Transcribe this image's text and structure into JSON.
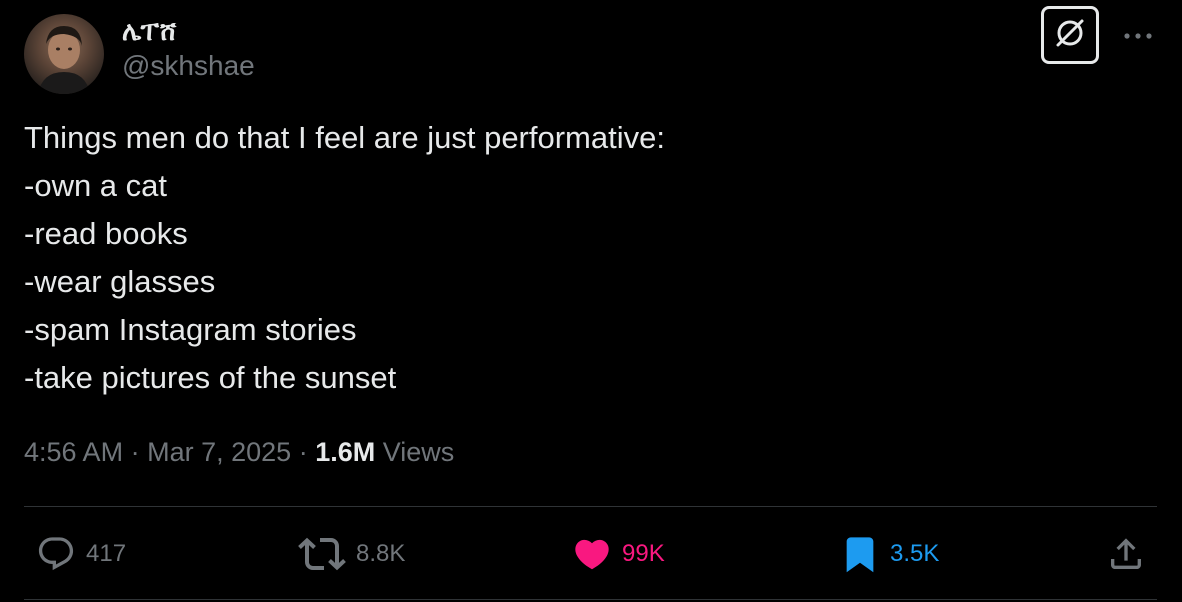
{
  "author": {
    "display_name": "ሌፐሸ",
    "handle": "@skhshae"
  },
  "tweet": {
    "lines": [
      "Things men do that I feel are just performative:",
      "-own a cat",
      "-read books",
      "-wear glasses",
      "-spam Instagram stories",
      "-take pictures of the sunset"
    ],
    "time": "4:56 AM",
    "date": "Mar 7, 2025",
    "views_count": "1.6M",
    "views_label": "Views"
  },
  "actions": {
    "replies": "417",
    "reposts": "8.8K",
    "likes": "99K",
    "bookmarks": "3.5K"
  },
  "icons": {
    "grok": "grok-icon",
    "more": "more-horizontal-icon",
    "reply": "reply-icon",
    "repost": "repost-icon",
    "like": "heart-icon",
    "bookmark": "bookmark-icon",
    "share": "share-icon"
  },
  "colors": {
    "background": "#000000",
    "text": "#e7e9ea",
    "muted": "#71767b",
    "like": "#f91880",
    "bookmark": "#1d9bf0",
    "divider": "#2f3336"
  }
}
